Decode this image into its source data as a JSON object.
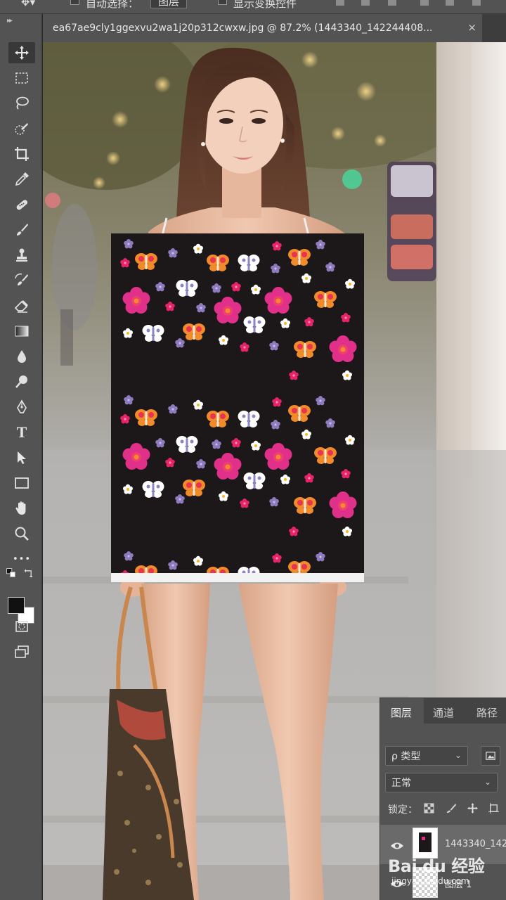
{
  "options_bar": {
    "auto_select_label": "自动选择：",
    "auto_select_target": "图层",
    "show_transform_label": "显示变换控件"
  },
  "document": {
    "tab_title": "ea67ae9cly1ggexvu2wa1j20p312cwxw.jpg @ 87.2% (1443340_142244408...",
    "close_glyph": "×"
  },
  "toolbar": {
    "tools": [
      "move-tool",
      "marquee-tool",
      "lasso-tool",
      "quick-select-tool",
      "crop-tool",
      "eyedropper-tool",
      "healing-brush-tool",
      "brush-tool",
      "clone-stamp-tool",
      "history-brush-tool",
      "eraser-tool",
      "gradient-tool",
      "blur-tool",
      "dodge-tool",
      "pen-tool",
      "type-tool",
      "path-select-tool",
      "rectangle-tool",
      "hand-tool",
      "zoom-tool",
      "more-tools"
    ],
    "type_glyph": "T",
    "more_glyph": "•••",
    "foreground_color": "#111111",
    "background_color": "#ffffff"
  },
  "layers_panel": {
    "tabs": [
      "图层",
      "通道",
      "路径"
    ],
    "filter_label": "ρ 类型",
    "blend_mode": "正常",
    "lock_label": "锁定：",
    "layers": [
      {
        "name": "1443340_142",
        "visible": true,
        "selected": true
      },
      {
        "name": "图层 1",
        "visible": true,
        "selected": false
      }
    ]
  },
  "watermark": {
    "brand": "Bai du 经验",
    "url": "jingyan.baidu.com"
  },
  "colors": {
    "ui_panel": "#535353",
    "ui_dark": "#3d3d3d",
    "poster_bg": "#1c1718"
  }
}
